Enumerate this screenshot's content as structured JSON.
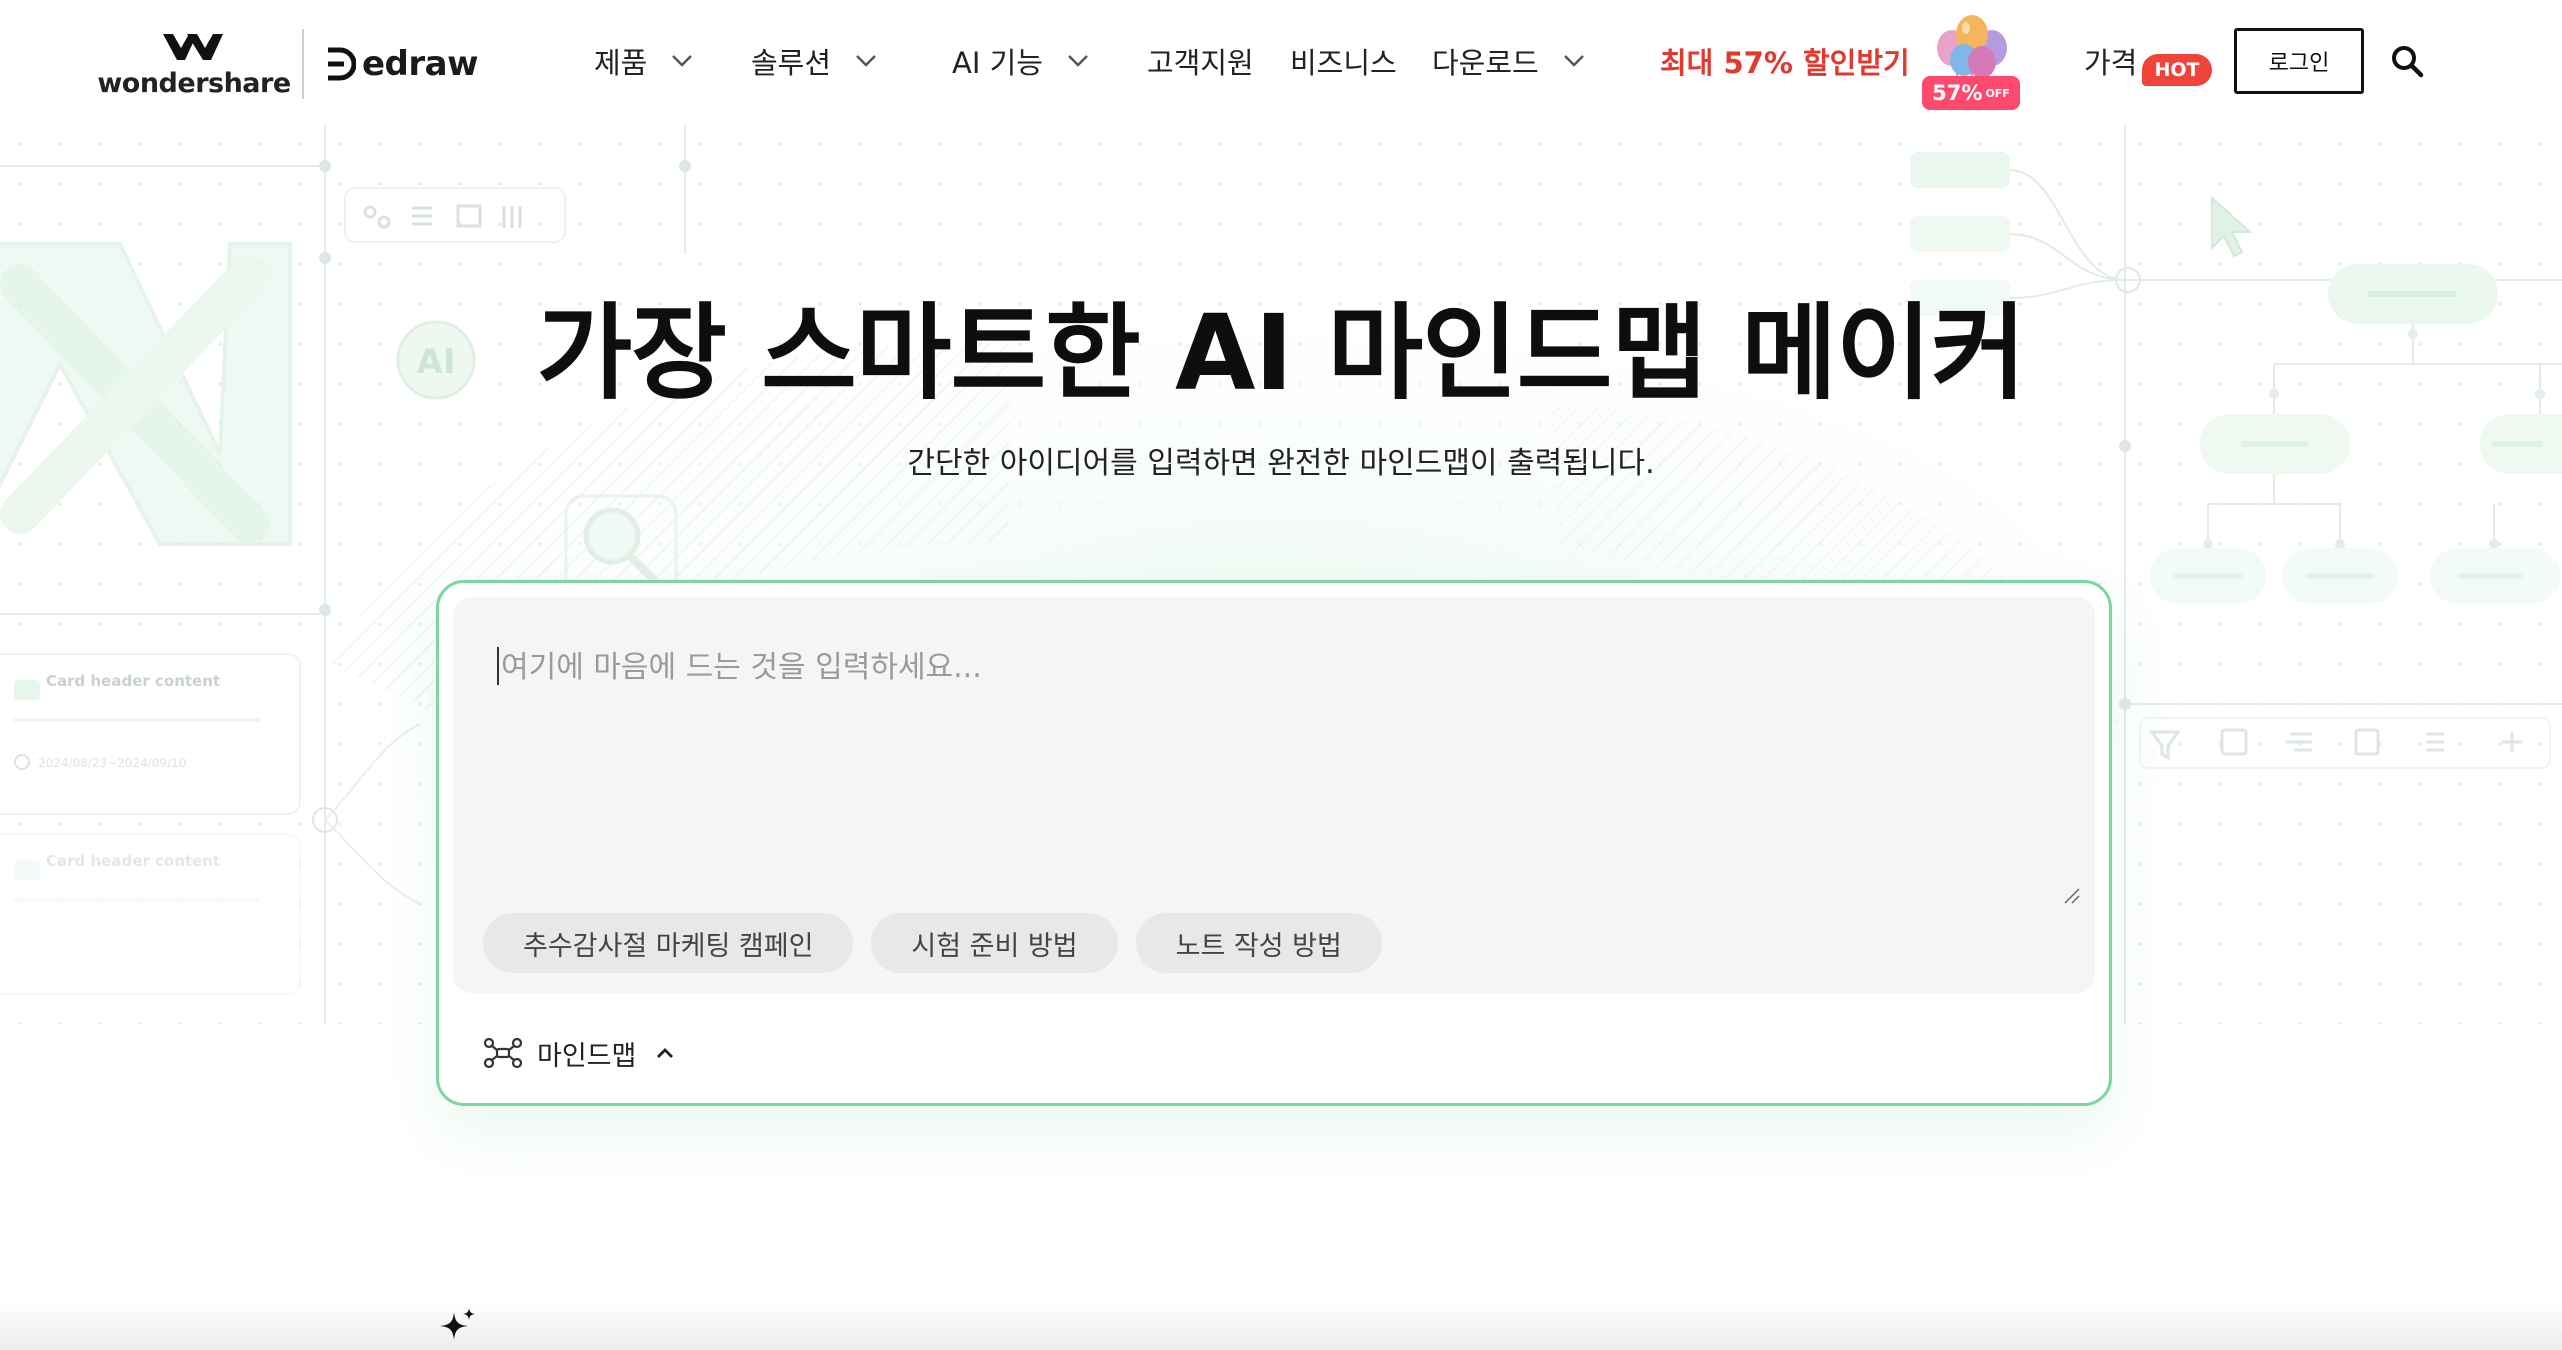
{
  "brand": {
    "wondershare": "wondershare",
    "edraw": "edraw"
  },
  "nav": {
    "items": [
      {
        "label": "제품",
        "has_dropdown": true
      },
      {
        "label": "솔루션",
        "has_dropdown": true
      },
      {
        "label": "AI 기능",
        "has_dropdown": true
      },
      {
        "label": "고객지원",
        "has_dropdown": false
      },
      {
        "label": "비즈니스",
        "has_dropdown": false
      },
      {
        "label": "다운로드",
        "has_dropdown": true
      }
    ],
    "promo": "최대 57% 할인받기",
    "promo_badge": "57%",
    "promo_badge_suffix": "OFF",
    "pricing": "가격",
    "hot_badge": "HOT",
    "login": "로그인"
  },
  "hero": {
    "title": "가장 스마트한 AI 마인드맵 메이커",
    "subtitle": "간단한 아이디어를 입력하면 완전한 마인드맵이 출력됩니다."
  },
  "prompt": {
    "placeholder": "여기에 마음에 드는 것을 입력하세요...",
    "value": "",
    "chips": [
      "추수감사절 마케팅 캠페인",
      "시험 준비 방법",
      "노트 작성 방법"
    ],
    "mode": "마인드맵"
  },
  "decor": {
    "card_header": "Card header content",
    "card_date": "2024/08/23~2024/09/10",
    "ai_label": "AI"
  },
  "colors": {
    "accent_green": "#7ad7a0",
    "promo_red": "#e03a2e",
    "hot_red": "#f0433a",
    "badge_pink": "#ff4a6e"
  }
}
